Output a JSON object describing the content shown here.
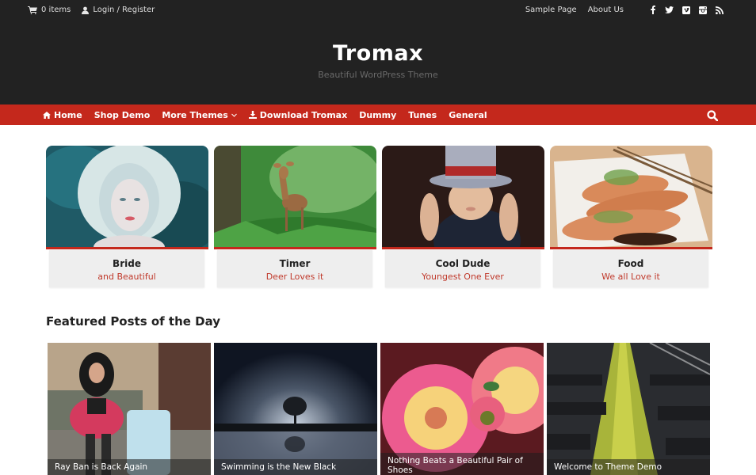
{
  "topbar": {
    "cart_label": "0 items",
    "login_label": "Login / Register",
    "links": [
      "Sample Page",
      "About Us"
    ],
    "social_icons": [
      "facebook-icon",
      "twitter-icon",
      "vimeo-icon",
      "instagram-icon",
      "rss-icon"
    ]
  },
  "site": {
    "title": "Tromax",
    "tagline": "Beautiful WordPress Theme"
  },
  "nav": {
    "items": [
      {
        "label": "Home",
        "icon": "home-icon"
      },
      {
        "label": "Shop Demo"
      },
      {
        "label": "More Themes",
        "has_dropdown": true
      },
      {
        "label": "Download Tromax",
        "icon": "download-icon"
      },
      {
        "label": "Dummy"
      },
      {
        "label": "Tunes"
      },
      {
        "label": "General"
      }
    ],
    "search_icon": "search-icon"
  },
  "colors": {
    "header_bg": "#222222",
    "accent": "#c4281c",
    "caption_bg": "#eeeeee",
    "subtitle": "#c0392b"
  },
  "feature_cards": [
    {
      "title": "Bride",
      "subtitle": "and Beautiful"
    },
    {
      "title": "Timer",
      "subtitle": "Deer Loves it"
    },
    {
      "title": "Cool Dude",
      "subtitle": "Youngest One Ever"
    },
    {
      "title": "Food",
      "subtitle": "We all Love it"
    }
  ],
  "featured": {
    "heading": "Featured Posts of the Day",
    "posts": [
      {
        "title": "Ray Ban is Back Again"
      },
      {
        "title": "Swimming is the New Black"
      },
      {
        "title": "Nothing Beats a Beautiful Pair of Shoes"
      },
      {
        "title": "Welcome to Theme Demo"
      }
    ]
  }
}
